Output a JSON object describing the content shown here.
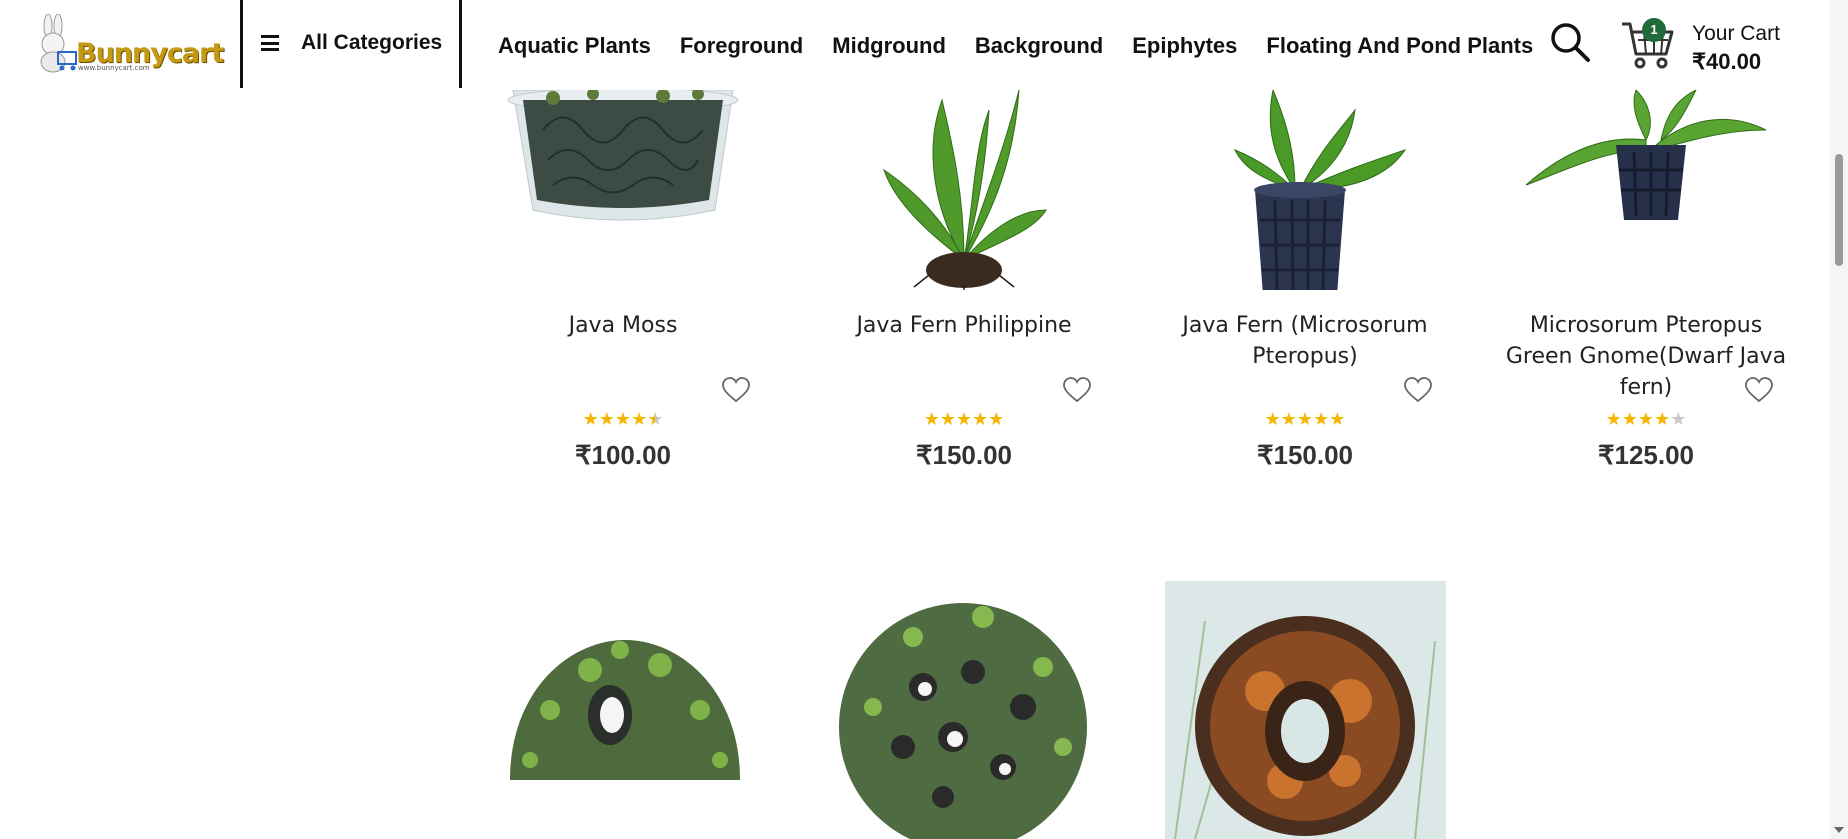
{
  "header": {
    "logo_text": "Bunnycart",
    "logo_url": "www.bunnycart.com",
    "all_categories": "All Categories",
    "nav": [
      "Aquatic Plants",
      "Foreground",
      "Midground",
      "Background",
      "Epiphytes",
      "Floating And Pond Plants"
    ],
    "cart": {
      "count": "1",
      "title": "Your Cart",
      "total": "₹40.00"
    }
  },
  "products": [
    {
      "name": "Java Moss",
      "rating": 4.5,
      "price": "₹100.00"
    },
    {
      "name": "Java Fern Philippine",
      "rating": 5,
      "price": "₹150.00"
    },
    {
      "name": "Java Fern (Microsorum Pteropus)",
      "rating": 5,
      "price": "₹150.00"
    },
    {
      "name": "Microsorum Pteropus Green Gnome(Dwarf Java fern)",
      "rating": 4,
      "price": "₹125.00"
    }
  ],
  "colors": {
    "star": "#f6b600",
    "star_off": "#c8c8c8",
    "cart_badge": "#1f6b3a",
    "logo": "#c49a12"
  }
}
